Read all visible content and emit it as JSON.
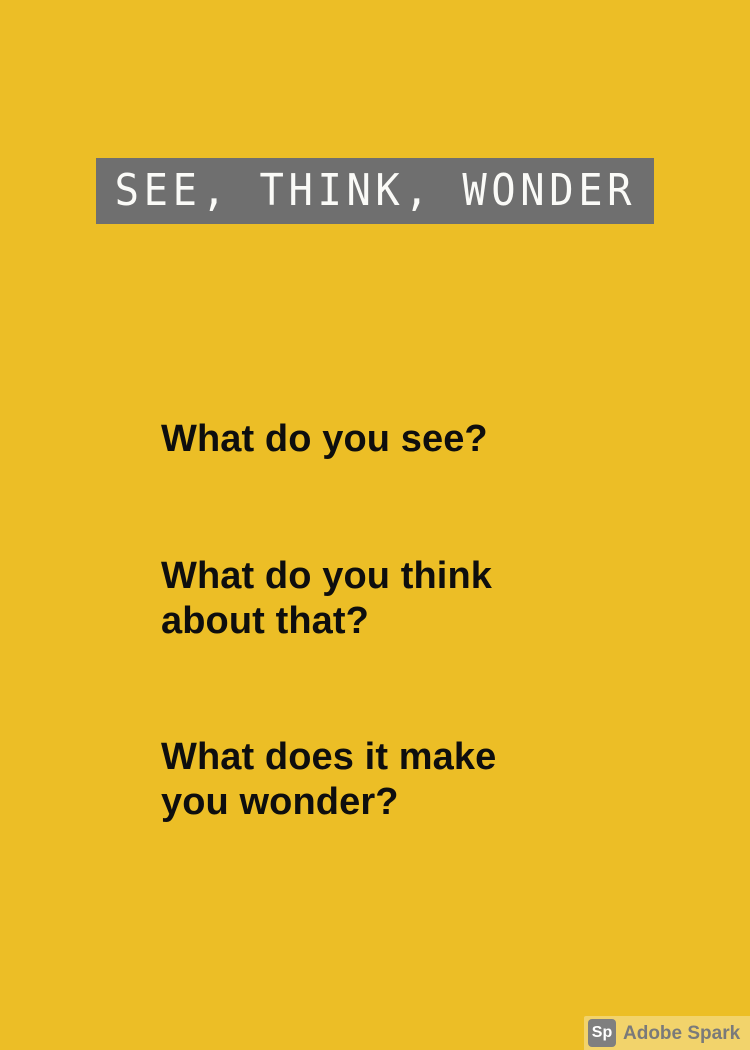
{
  "header": {
    "title": "SEE, THINK, WONDER"
  },
  "questions": {
    "q1": "What do you see?",
    "q2_line1": "What do you think",
    "q2_line2": "about that?",
    "q3_line1": "What does it make",
    "q3_line2": "you wonder?"
  },
  "brand": {
    "mark": "Sp",
    "text": "Adobe Spark"
  },
  "colors": {
    "background": "#ECBE26",
    "title_bg": "#6F6F6F",
    "title_text": "#FAFAF7",
    "question_text": "#0E0E0E"
  }
}
